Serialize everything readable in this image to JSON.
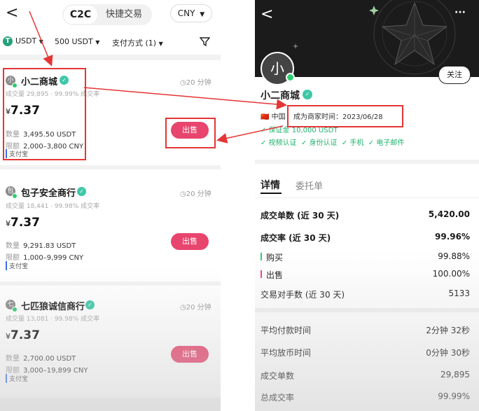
{
  "left": {
    "header": {
      "back_glyph": "<",
      "tab_c2c": "C2C",
      "tab_quick": "快捷交易",
      "currency": "CNY"
    },
    "filters": {
      "asset": "USDT",
      "asset_icon_letter": "T",
      "amount": "500 USDT",
      "payment": "支付方式 (1)"
    },
    "merchants": [
      {
        "avatar": "小",
        "name": "小二商城",
        "time": "20 分钟",
        "stats": "成交量 29,895  ·  99.99% 成交率",
        "price_symbol": "¥",
        "price": "7.37",
        "qty_label": "数量",
        "qty": "3,495.50 USDT",
        "limit_label": "限额",
        "limit": "2,000–3,800 CNY",
        "payment": "支付宝",
        "action": "出售"
      },
      {
        "avatar": "包",
        "name": "包子安全商行",
        "time": "20 分钟",
        "stats": "成交量 18,441  ·  99.98% 成交率",
        "price_symbol": "¥",
        "price": "7.37",
        "qty_label": "数量",
        "qty": "9,291.83 USDT",
        "limit_label": "限额",
        "limit": "1,000–9,999 CNY",
        "payment": "支付宝",
        "action": "出售"
      },
      {
        "avatar": "七",
        "name": "七匹狼诚信商行",
        "time": "20 分钟",
        "stats": "成交量 13,081  ·  99.98% 成交率",
        "price_symbol": "¥",
        "price": "7.37",
        "qty_label": "数量",
        "qty": "2,700.00 USDT",
        "limit_label": "限额",
        "limit": "3,000–19,899 CNY",
        "payment": "支付宝",
        "action": "出售"
      }
    ]
  },
  "right": {
    "back_glyph": "<",
    "more_glyph": "···",
    "avatar": "小",
    "follow": "关注",
    "name": "小二商城",
    "flag": "🇨🇳",
    "country": "中国",
    "merchant_since": "成为商家时间：2023/06/28",
    "deposit": "✓ 保证金 10,000 USDT",
    "verifications": [
      "✓ 视频认证",
      "✓ 身份认证",
      "✓ 手机",
      "✓ 电子邮件"
    ],
    "tabs": {
      "details": "详情",
      "orders": "委托单"
    },
    "stats": [
      {
        "label": "成交单数 (近 30 天)",
        "value": "5,420.00",
        "bold": true
      },
      {
        "label": "成交率 (近 30 天)",
        "value": "99.96%",
        "bold": true
      },
      {
        "label": "购买",
        "value": "99.88%",
        "mark": "green"
      },
      {
        "label": "出售",
        "value": "100.00%",
        "mark": "red"
      },
      {
        "label": "交易对手数 (近 30 天)",
        "value": "5133"
      }
    ],
    "stats2": [
      {
        "label": "平均付款时间",
        "value": "2分钟 32秒"
      },
      {
        "label": "平均放币时间",
        "value": "0分钟 30秒"
      },
      {
        "label": "成交单数",
        "value": "29,895"
      },
      {
        "label": "总成交率",
        "value": "99.99%"
      }
    ]
  },
  "colors": {
    "sell_button": "#e8456e",
    "annotation_red": "#e53535",
    "verify_green": "#20b36c",
    "tether": "#26a17b"
  }
}
